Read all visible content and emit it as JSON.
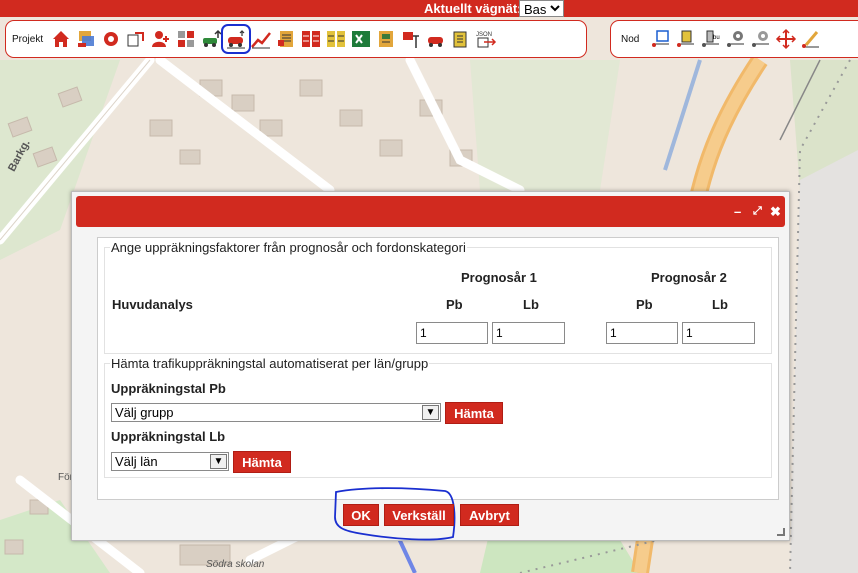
{
  "topbar": {
    "label": "Aktuellt vägnät:",
    "network_value": "Bas"
  },
  "toolbar_left": {
    "label": "Projekt"
  },
  "toolbar_right": {
    "label": "Nod"
  },
  "map": {
    "labels": [
      "Barkg.",
      "För",
      "Södra skolan"
    ]
  },
  "dialog": {
    "minimize": "–",
    "maximize": "⤢",
    "close": "✖",
    "section1": {
      "legend": "Ange uppräkningsfaktorer från prognosår och fordonskategori",
      "row_label": "Huvudanalys",
      "year1": "Prognosår 1",
      "year2": "Prognosår 2",
      "pb": "Pb",
      "lb": "Lb",
      "values": [
        "1",
        "1",
        "1",
        "1"
      ]
    },
    "section2": {
      "legend": "Hämta trafikuppräkningstal automatiserat per län/grupp",
      "pb_label": "Uppräkningstal Pb",
      "pb_select": "Välj grupp",
      "lb_label": "Uppräkningstal Lb",
      "lb_select": "Välj län",
      "fetch": "Hämta"
    },
    "buttons": {
      "ok": "OK",
      "apply": "Verkställ",
      "cancel": "Avbryt"
    }
  }
}
